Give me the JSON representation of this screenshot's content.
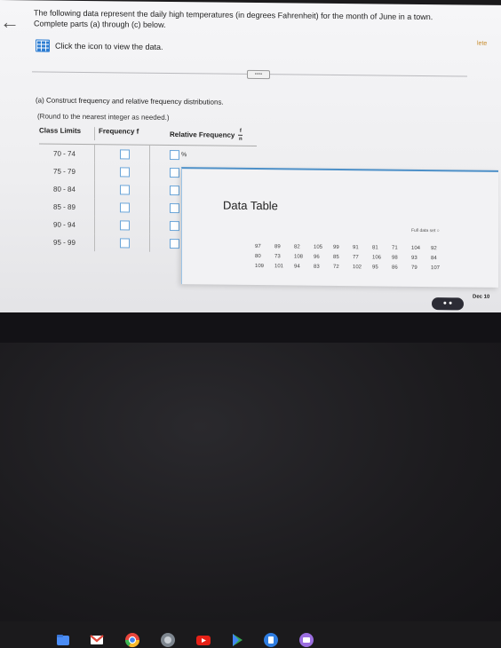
{
  "question": {
    "text": "The following data represent the daily high temperatures (in degrees Fahrenheit) for the month of June in a town. Complete parts (a) through (c) below.",
    "view_data_label": "Click the icon to view the data."
  },
  "right_edge_text": "lete",
  "right_edge_text2": "lete",
  "part_a": {
    "heading": "(a) Construct frequency and relative frequency distributions.",
    "round_note": "(Round to the nearest integer as needed.)",
    "columns": {
      "class_limits": "Class Limits",
      "frequency": "Frequency f",
      "relative_frequency": "Relative Frequency",
      "frac_num": "f",
      "frac_den": "n"
    },
    "rows": [
      {
        "class": "70 - 74"
      },
      {
        "class": "75 - 79"
      },
      {
        "class": "80 - 84"
      },
      {
        "class": "85 - 89"
      },
      {
        "class": "90 - 94"
      },
      {
        "class": "95 - 99"
      }
    ],
    "pct_sign": "%"
  },
  "data_table": {
    "title": "Data Table",
    "full_data_label": "Full data set",
    "rows": [
      [
        "97",
        "89",
        "82",
        "105",
        "99",
        "91",
        "81",
        "71",
        "104",
        "92"
      ],
      [
        "80",
        "73",
        "108",
        "96",
        "85",
        "77",
        "106",
        "98",
        "93",
        "84"
      ],
      [
        "109",
        "101",
        "94",
        "83",
        "72",
        "102",
        "95",
        "86",
        "79",
        "107"
      ]
    ]
  },
  "system": {
    "date": "Dec 10"
  },
  "colors": {
    "accent": "#4d90c8",
    "input_border": "#6aa5d9"
  }
}
